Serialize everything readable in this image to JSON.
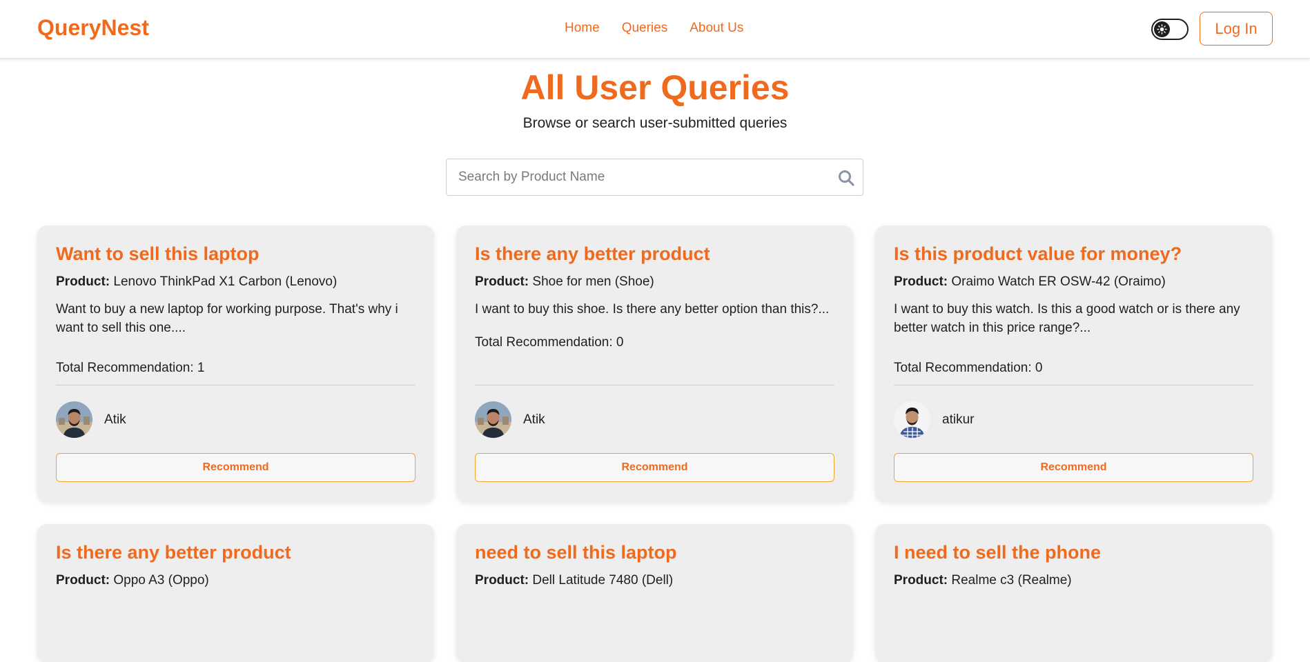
{
  "header": {
    "brand": "QueryNest",
    "nav": [
      "Home",
      "Queries",
      "About Us"
    ],
    "login_label": "Log In",
    "theme_toggle_icon": "sun-icon"
  },
  "hero": {
    "title": "All User Queries",
    "subtitle": "Browse or search user-submitted queries"
  },
  "search": {
    "placeholder": "Search by Product Name",
    "value": "",
    "icon": "search-icon"
  },
  "product_prefix": "Product:",
  "recommend_label": "Recommend",
  "reco_prefix": "Total Recommendation:",
  "cards": [
    {
      "title": "Want to sell this laptop",
      "product": "Lenovo ThinkPad X1 Carbon (Lenovo)",
      "description": "Want to buy a new laptop for working purpose. That's why i want to sell this one....",
      "recommendation_count": "1",
      "user": "Atik"
    },
    {
      "title": "Is there any better product",
      "product": "Shoe for men (Shoe)",
      "description": "I want to buy this shoe. Is there any better option than this?...",
      "recommendation_count": "0",
      "user": "Atik"
    },
    {
      "title": "Is this product value for money?",
      "product": "Oraimo Watch ER OSW-42 (Oraimo)",
      "description": "I want to buy this watch. Is this a good watch or is there any better watch in this price range?...",
      "recommendation_count": "0",
      "user": "atikur"
    },
    {
      "title": "Is there any better product",
      "product": "Oppo A3 (Oppo)"
    },
    {
      "title": "need to sell this laptop",
      "product": "Dell Latitude 7480 (Dell)"
    },
    {
      "title": "I need to sell the phone",
      "product": "Realme c3 (Realme)"
    }
  ],
  "colors": {
    "accent": "#f06a1d",
    "button_border": "#f2a32b",
    "card_bg": "#eeeeee"
  }
}
